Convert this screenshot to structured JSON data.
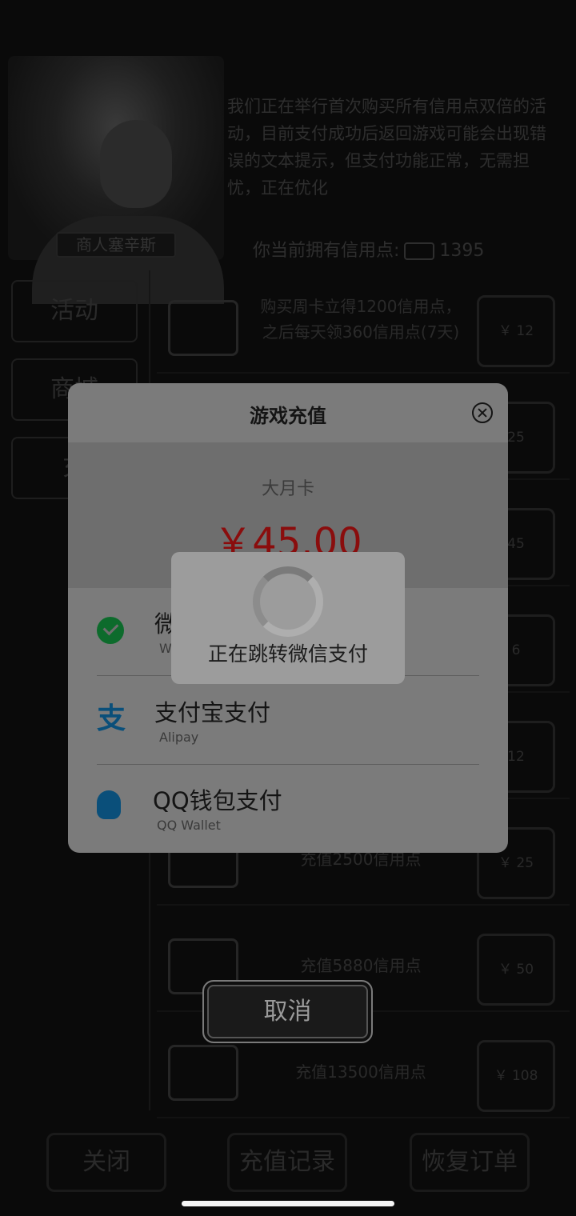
{
  "background": {
    "merchant_name": "商人塞辛斯",
    "notice": "我们正在举行首次购买所有信用点双倍的活动，目前支付成功后返回游戏可能会出现错误的文本提示，但支付功能正常，无需担忧，正在优化",
    "credits_label": "你当前拥有信用点:",
    "credits_value": "1395",
    "sidebar": [
      "活动",
      "商城",
      "充"
    ],
    "rows": [
      {
        "text": "购买周卡立得1200信用点，之后每天领360信用点(7天)",
        "price": "￥ 12"
      },
      {
        "text": "",
        "price": "25"
      },
      {
        "text": "",
        "price": "45"
      },
      {
        "text": "",
        "price": "6"
      },
      {
        "text": "",
        "price": "12"
      },
      {
        "text": "充值2500信用点",
        "price": "￥ 25"
      },
      {
        "text": "充值5880信用点",
        "price": "￥ 50"
      },
      {
        "text": "充值13500信用点",
        "price": "￥ 108"
      }
    ],
    "bottom": [
      "关闭",
      "充值记录",
      "恢复订单"
    ]
  },
  "dialog": {
    "title": "游戏充值",
    "product_name": "大月卡",
    "price": "￥45.00",
    "options": [
      {
        "name": "微信支付",
        "sub": "We Ch",
        "icon": "wechat-icon"
      },
      {
        "name": "支付宝支付",
        "sub": "Alipay",
        "icon": "alipay-icon",
        "glyph": "支"
      },
      {
        "name": "QQ钱包支付",
        "sub": "QQ  Wallet",
        "icon": "qq-icon"
      }
    ]
  },
  "loading": {
    "text": "正在跳转微信支付"
  },
  "cancel": {
    "label": "取消"
  }
}
